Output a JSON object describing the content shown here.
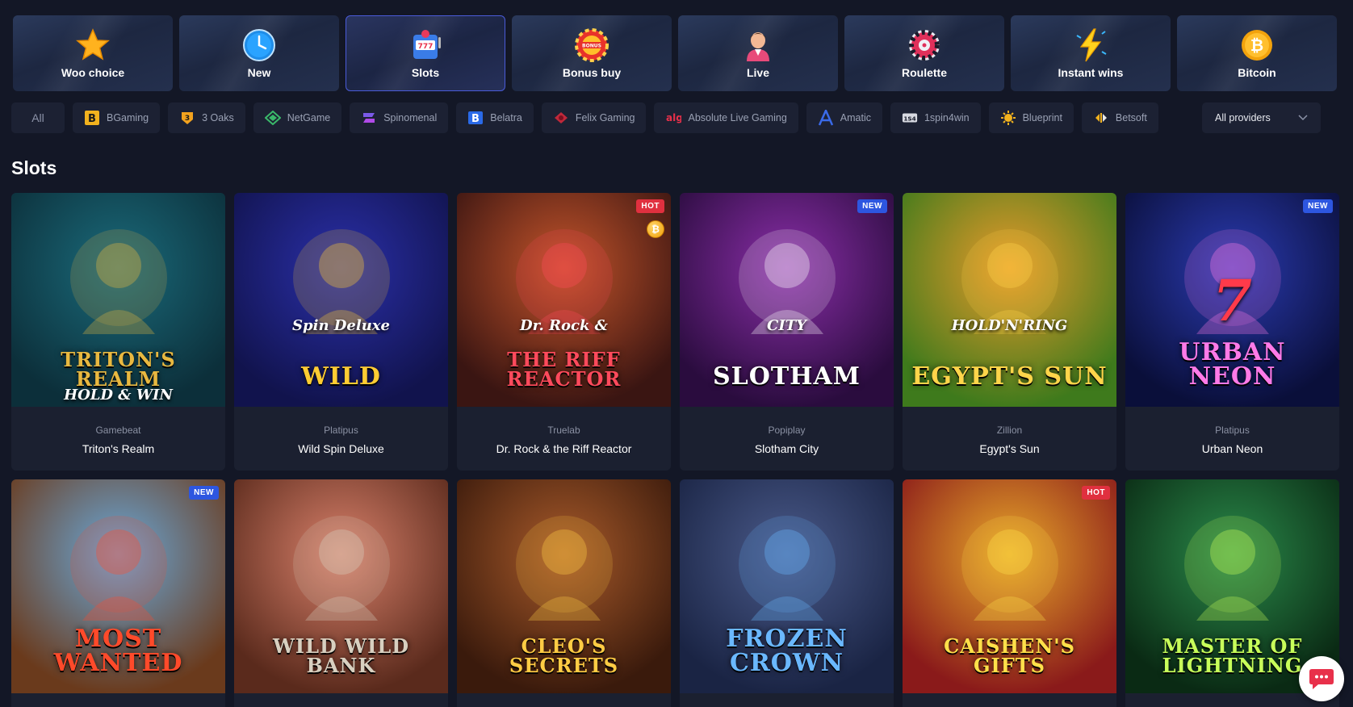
{
  "categories": [
    {
      "label": "Woo choice",
      "icon": "star-icon"
    },
    {
      "label": "New",
      "icon": "clock-icon"
    },
    {
      "label": "Slots",
      "icon": "slot-machine-icon",
      "active": true
    },
    {
      "label": "Bonus buy",
      "icon": "bonus-chip-icon"
    },
    {
      "label": "Live",
      "icon": "dealer-icon"
    },
    {
      "label": "Roulette",
      "icon": "roulette-wheel-icon"
    },
    {
      "label": "Instant wins",
      "icon": "lightning-icon"
    },
    {
      "label": "Bitcoin",
      "icon": "bitcoin-coin-icon"
    }
  ],
  "providers": {
    "all_label": "All",
    "items": [
      {
        "label": "BGaming",
        "icon": "bgaming-logo-icon"
      },
      {
        "label": "3 Oaks",
        "icon": "3oaks-logo-icon"
      },
      {
        "label": "NetGame",
        "icon": "netgame-logo-icon"
      },
      {
        "label": "Spinomenal",
        "icon": "spinomenal-logo-icon"
      },
      {
        "label": "Belatra",
        "icon": "belatra-logo-icon"
      },
      {
        "label": "Felix Gaming",
        "icon": "felix-gaming-logo-icon"
      },
      {
        "label": "Absolute Live Gaming",
        "icon": "alg-logo-icon"
      },
      {
        "label": "Amatic",
        "icon": "amatic-logo-icon"
      },
      {
        "label": "1spin4win",
        "icon": "1spin4win-logo-icon"
      },
      {
        "label": "Blueprint",
        "icon": "blueprint-logo-icon"
      },
      {
        "label": "Betsoft",
        "icon": "betsoft-logo-icon"
      }
    ],
    "select_label": "All providers"
  },
  "section_title": "Slots",
  "games": [
    {
      "provider": "Gamebeat",
      "name": "Triton's Realm",
      "art_title": "TRITON'S REALM",
      "art_sub": "HOLD & WIN",
      "badge": "",
      "bg1": "#1a6a7a",
      "bg2": "#0c2f3a",
      "title_color": "#e8b840"
    },
    {
      "provider": "Platipus",
      "name": "Wild Spin Deluxe",
      "art_title": "WILD",
      "art_sub": "Spin Deluxe",
      "badge": "",
      "bg1": "#2a2fa8",
      "bg2": "#11134d",
      "title_color": "#ffcc33"
    },
    {
      "provider": "Truelab",
      "name": "Dr. Rock & the Riff Reactor",
      "art_title": "THE RIFF REACTOR",
      "art_sub": "Dr. Rock &",
      "badge": "HOT",
      "coin": "₿",
      "bg1": "#c4542a",
      "bg2": "#3a1512",
      "title_color": "#ff4a5c"
    },
    {
      "provider": "Popiplay",
      "name": "Slotham City",
      "art_title": "SLOTHAM",
      "art_sub": "CITY",
      "badge": "NEW",
      "bg1": "#8a2ea8",
      "bg2": "#2a0c3e",
      "title_color": "#ffffff"
    },
    {
      "provider": "Zillion",
      "name": "Egypt's Sun",
      "art_title": "EGYPT'S SUN",
      "art_sub": "HOLD'N'RING",
      "badge": "",
      "bg1": "#e89a2a",
      "bg2": "#3e7a1c",
      "title_color": "#ffd54a"
    },
    {
      "provider": "Platipus",
      "name": "Urban Neon",
      "art_title": "URBAN NEON",
      "art_sub": "7",
      "badge": "NEW",
      "bg1": "#2a3ab0",
      "bg2": "#0a0f3a",
      "title_color": "#ff7ae8"
    },
    {
      "provider": "",
      "name": "",
      "art_title": "MOST WANTED",
      "art_sub": "",
      "badge": "NEW",
      "bg1": "#6aa8d8",
      "bg2": "#6a3a1c",
      "title_color": "#ff4a2a"
    },
    {
      "provider": "",
      "name": "",
      "art_title": "WILD WILD BANK",
      "art_sub": "",
      "badge": "",
      "bg1": "#d8806a",
      "bg2": "#5a2a1c",
      "title_color": "#d8d0c0"
    },
    {
      "provider": "",
      "name": "",
      "art_title": "CLEO'S SECRETS",
      "art_sub": "",
      "badge": "",
      "bg1": "#a85a2a",
      "bg2": "#3a1a0c",
      "title_color": "#ffcc44"
    },
    {
      "provider": "",
      "name": "",
      "art_title": "FROZEN CROWN",
      "art_sub": "",
      "badge": "",
      "bg1": "#4a5a8a",
      "bg2": "#1a2444",
      "title_color": "#6ab8ff"
    },
    {
      "provider": "",
      "name": "",
      "art_title": "CAISHEN'S GIFTS",
      "art_sub": "",
      "badge": "HOT",
      "bg1": "#e8a82a",
      "bg2": "#8a1a1a",
      "title_color": "#ffe04a"
    },
    {
      "provider": "",
      "name": "",
      "art_title": "MASTER OF LIGHTNING",
      "art_sub": "",
      "badge": "",
      "bg1": "#2a8a4a",
      "bg2": "#0a2a14",
      "title_color": "#c8ff5a"
    }
  ],
  "chat": {
    "icon": "chat-bubble-icon"
  }
}
